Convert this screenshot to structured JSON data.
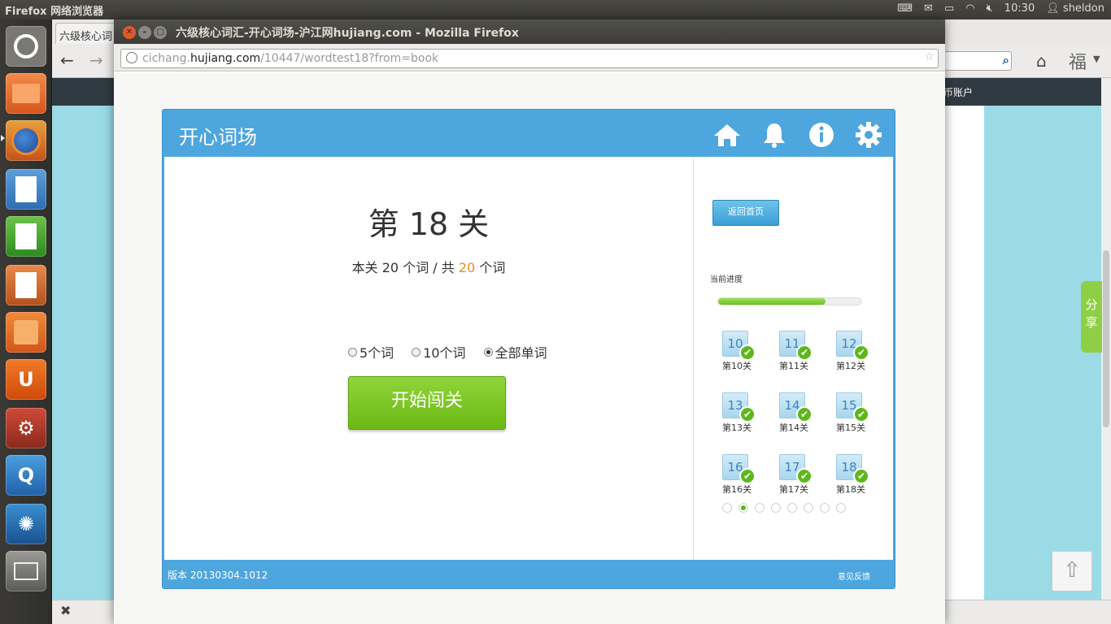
{
  "panel": {
    "app_name": "Firefox 网络浏览器",
    "time": "10:30",
    "user": "sheldon"
  },
  "launcher": [
    "ubuntu-dash",
    "files",
    "firefox",
    "writer",
    "calc",
    "impress",
    "software-center",
    "ubuntu-one",
    "system-settings",
    "app-q",
    "app-swirl",
    "workspace"
  ],
  "background_window": {
    "tab_label": "六级核心词",
    "account_text": "币账户",
    "share_label": "分享",
    "fu_char": "福"
  },
  "window": {
    "title": "六级核心词汇-开心词场-沪江网hujiang.com - Mozilla Firefox",
    "url": {
      "prefix": "cichang.",
      "domain": "hujiang.com",
      "path": "/10447/wordtest18?from=book"
    }
  },
  "app": {
    "title": "开心词场",
    "header_icons": [
      "home-icon",
      "bell-icon",
      "info-icon",
      "gear-icon"
    ],
    "level": {
      "prefix": "第",
      "number": "18",
      "suffix": "关"
    },
    "counts": {
      "left_a": "本关",
      "total": "20",
      "left_b": "个词",
      "sep": " / ",
      "right_a": "共",
      "highlight": "20",
      "right_b": "个词"
    },
    "options": [
      {
        "label": "5个词",
        "selected": false
      },
      {
        "label": "10个词",
        "selected": false
      },
      {
        "label": "全部单词",
        "selected": true
      }
    ],
    "start_label": "开始闯关",
    "side_button": "返回首页",
    "progress_label": "当前进度",
    "progress_fraction": 0.75,
    "levels": [
      {
        "num": "10",
        "label": "第10关"
      },
      {
        "num": "11",
        "label": "第11关"
      },
      {
        "num": "12",
        "label": "第12关"
      },
      {
        "num": "13",
        "label": "第13关"
      },
      {
        "num": "14",
        "label": "第14关"
      },
      {
        "num": "15",
        "label": "第15关"
      },
      {
        "num": "16",
        "label": "第16关"
      },
      {
        "num": "17",
        "label": "第17关"
      },
      {
        "num": "18",
        "label": "第18关"
      }
    ],
    "pager": {
      "count": 8,
      "active": 1
    },
    "footer": {
      "version": "版本 20130304.1012",
      "link": "意见反馈"
    }
  },
  "colors": {
    "accent": "#4ea6de",
    "start_green": "#7ac625",
    "highlight_orange": "#f08a1c"
  }
}
